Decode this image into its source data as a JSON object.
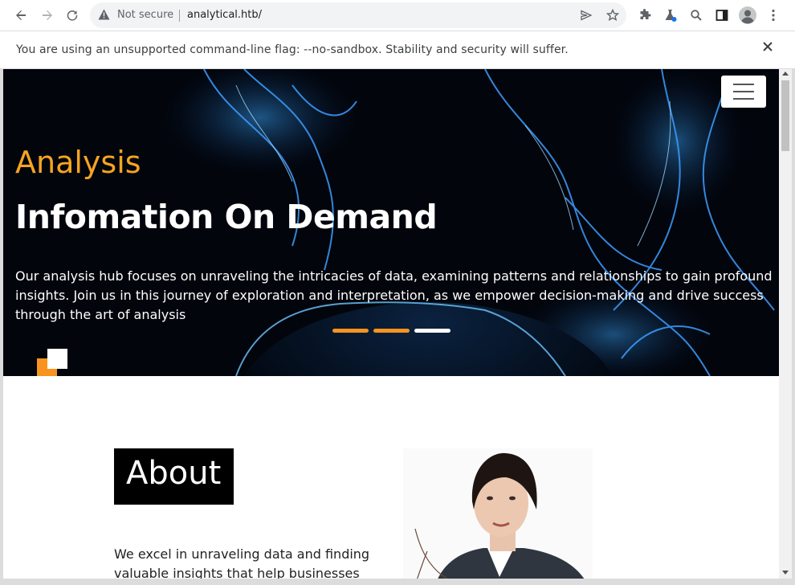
{
  "browser": {
    "security_label": "Not secure",
    "url": "analytical.htb/",
    "icons": [
      "back-arrow-icon",
      "forward-arrow-icon",
      "reload-icon",
      "warning-icon",
      "send-icon",
      "star-icon",
      "extensions-icon",
      "flask-extension-icon",
      "search-icon",
      "sidebar-icon",
      "profile-icon",
      "more-vert-icon"
    ]
  },
  "infobar": {
    "message": "You are using an unsupported command-line flag: --no-sandbox. Stability and security will suffer."
  },
  "hero": {
    "subtitle": "Analysis",
    "title": "Infomation On Demand",
    "text": "Our analysis hub focuses on unraveling the intricacies of data, examining patterns and relationships to gain profound insights. Join us in this journey of exploration and interpretation, as we empower decision-making and drive success through the art of analysis",
    "carousel_active_index": 2,
    "colors": {
      "accent": "#f7a422",
      "indicator_active": "#ffffff",
      "indicator_inactive": "#f7931e"
    }
  },
  "about": {
    "title": "About",
    "text": "We excel in unraveling data and finding valuable insights that help businesses"
  }
}
